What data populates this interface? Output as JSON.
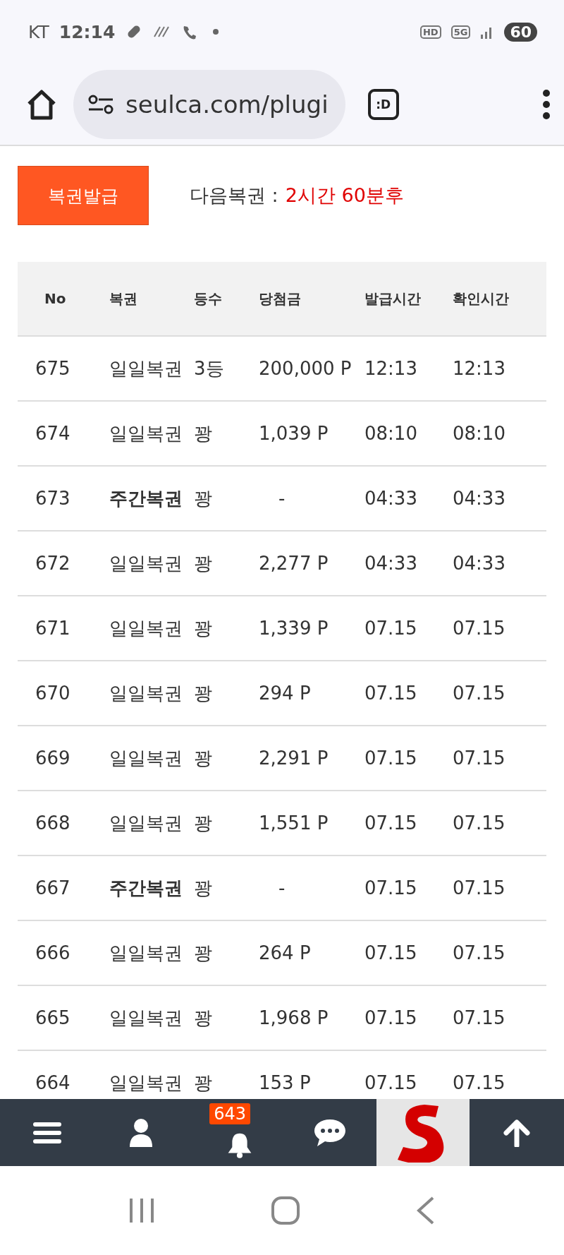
{
  "status_bar": {
    "carrier": "KT",
    "time": "12:14",
    "network_badges": [
      "HD",
      "5G"
    ],
    "battery": "60"
  },
  "browser": {
    "url": "seulca.com/plugi",
    "tab_label": ":D"
  },
  "issue_button": "복권발급",
  "next_label": "다음복권 :",
  "next_time": "2시간 60분후",
  "table": {
    "columns": [
      "No",
      "복권",
      "등수",
      "당첨금",
      "발급시간",
      "확인시간"
    ],
    "rows": [
      {
        "cells": [
          "675",
          "일일복권",
          "3등",
          "200,000 P",
          "12:13",
          "12:13"
        ],
        "bold": false
      },
      {
        "cells": [
          "674",
          "일일복권",
          "꽝",
          "1,039 P",
          "08:10",
          "08:10"
        ],
        "bold": false
      },
      {
        "cells": [
          "673",
          "주간복권",
          "꽝",
          "-",
          "04:33",
          "04:33"
        ],
        "bold": true
      },
      {
        "cells": [
          "672",
          "일일복권",
          "꽝",
          "2,277 P",
          "04:33",
          "04:33"
        ],
        "bold": false
      },
      {
        "cells": [
          "671",
          "일일복권",
          "꽝",
          "1,339 P",
          "07.15",
          "07.15"
        ],
        "bold": false
      },
      {
        "cells": [
          "670",
          "일일복권",
          "꽝",
          "294 P",
          "07.15",
          "07.15"
        ],
        "bold": false
      },
      {
        "cells": [
          "669",
          "일일복권",
          "꽝",
          "2,291 P",
          "07.15",
          "07.15"
        ],
        "bold": false
      },
      {
        "cells": [
          "668",
          "일일복권",
          "꽝",
          "1,551 P",
          "07.15",
          "07.15"
        ],
        "bold": false
      },
      {
        "cells": [
          "667",
          "주간복권",
          "꽝",
          "-",
          "07.15",
          "07.15"
        ],
        "bold": true
      },
      {
        "cells": [
          "666",
          "일일복권",
          "꽝",
          "264 P",
          "07.15",
          "07.15"
        ],
        "bold": false
      },
      {
        "cells": [
          "665",
          "일일복권",
          "꽝",
          "1,968 P",
          "07.15",
          "07.15"
        ],
        "bold": false
      },
      {
        "cells": [
          "664",
          "일일복권",
          "꽝",
          "153 P",
          "07.15",
          "07.15"
        ],
        "bold": false
      }
    ]
  },
  "bottom_nav": {
    "notification_count": "643"
  }
}
